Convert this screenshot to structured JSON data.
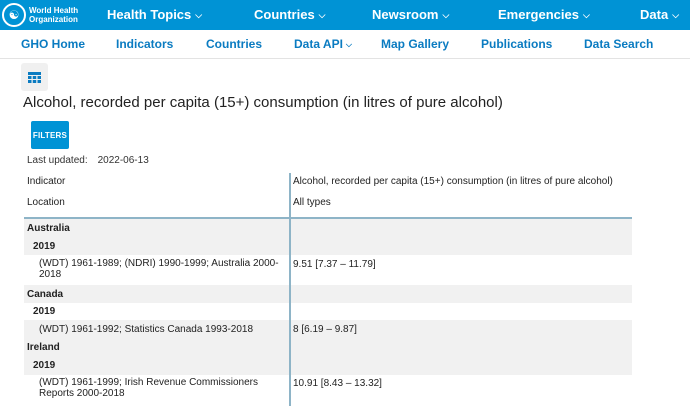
{
  "logo": {
    "line1": "World Health",
    "line2": "Organization"
  },
  "topnav": [
    {
      "label": "Health Topics",
      "chevron": true
    },
    {
      "label": "Countries",
      "chevron": true
    },
    {
      "label": "Newsroom",
      "chevron": true
    },
    {
      "label": "Emergencies",
      "chevron": true
    },
    {
      "label": "Data",
      "chevron": true
    }
  ],
  "subnav": [
    {
      "label": "GHO Home"
    },
    {
      "label": "Indicators"
    },
    {
      "label": "Countries"
    },
    {
      "label": "Data API",
      "chevron": true
    },
    {
      "label": "Map Gallery"
    },
    {
      "label": "Publications"
    },
    {
      "label": "Data Search"
    }
  ],
  "page": {
    "title": "Alcohol, recorded per capita (15+) consumption (in litres of pure alcohol)",
    "filters_label": "FILTERS",
    "last_updated_label": "Last updated:",
    "last_updated_value": "2022-06-13"
  },
  "table": {
    "header": {
      "indicator_label": "Indicator",
      "indicator_value": "Alcohol, recorded per capita (15+) consumption (in litres of pure alcohol)",
      "location_label": "Location",
      "location_value": "All types"
    },
    "rows": [
      {
        "location": "Australia",
        "year": "2019",
        "source": "(WDT) 1961-1989; (NDRI) 1990-1999; Australia 2000-2018",
        "value": "9.51 [7.37 – 11.79]"
      },
      {
        "location": "Canada",
        "year": "2019",
        "source": "(WDT) 1961-1992; Statistics Canada 1993-2018",
        "value": "8 [6.19 – 9.87]"
      },
      {
        "location": "Ireland",
        "year": "2019",
        "source": "(WDT) 1961-1999; Irish Revenue Commissioners Reports 2000-2018",
        "value": "10.91 [8.43 – 13.32]"
      }
    ]
  },
  "icons": {
    "logo": "globe-emblem-icon",
    "view": "table-grid-icon",
    "chevron": "chevron-down-icon"
  },
  "colors": {
    "brand_blue": "#0093d5",
    "link_blue": "#0a7bc1",
    "row_band": "#f1f1f1",
    "divider": "#8eb4c7"
  }
}
